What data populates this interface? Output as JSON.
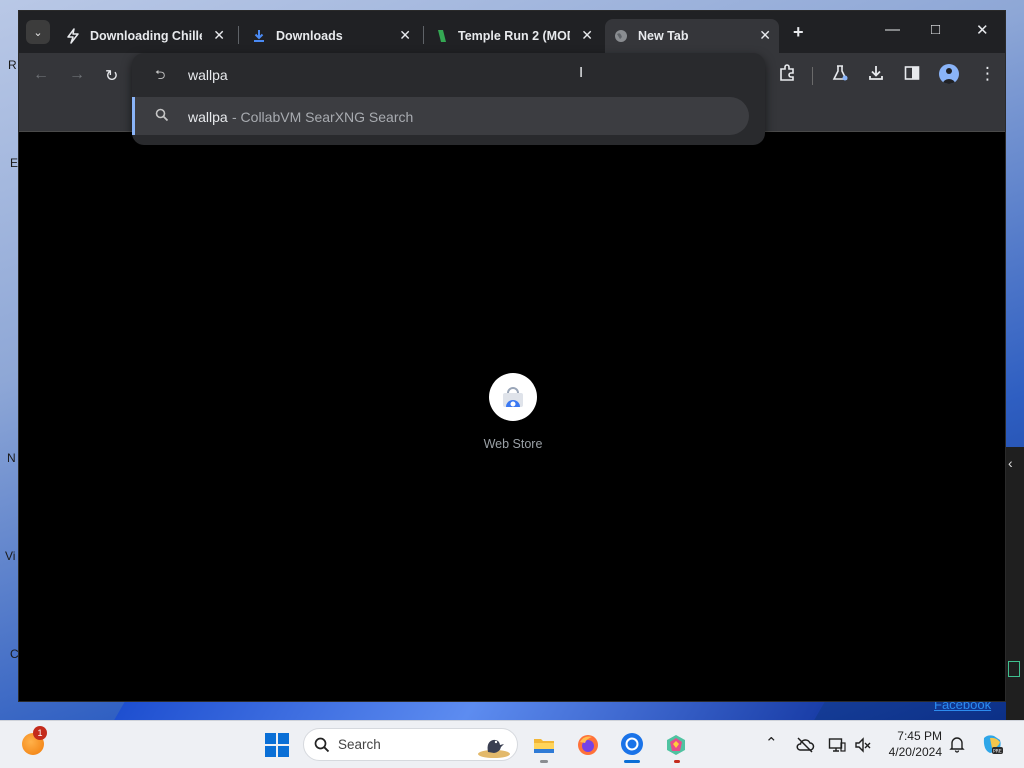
{
  "browser": {
    "tabs": [
      {
        "title": "Downloading Chilled",
        "icon": "bolt-icon",
        "active": false
      },
      {
        "title": "Downloads",
        "icon": "download-icon",
        "active": false
      },
      {
        "title": "Temple Run 2 (MOD",
        "icon": "temple-run-icon",
        "active": false
      },
      {
        "title": "New Tab",
        "icon": "globe-icon",
        "active": true
      }
    ],
    "omnibox": {
      "value": "wallpa",
      "suggestion_query": "wallpa",
      "suggestion_source": " - CollabVM SearXNG Search"
    },
    "shortcuts": [
      {
        "label": "Web Store",
        "icon": "web-store-icon"
      }
    ]
  },
  "desktop": {
    "facebook_link": "Facebook",
    "edge_letters": [
      "R",
      "E",
      "N",
      "Vi",
      "C"
    ]
  },
  "taskbar": {
    "search_placeholder": "Search",
    "notification_count": "1",
    "time": "7:45 PM",
    "date": "4/20/2024",
    "apps": [
      "file-explorer-icon",
      "firefox-icon",
      "chrome-icon",
      "copilot-icon"
    ],
    "colors": {
      "start_blue": "#0a6fd6",
      "badge_red": "#c42b1c",
      "accent": "#8ab4f8"
    }
  }
}
